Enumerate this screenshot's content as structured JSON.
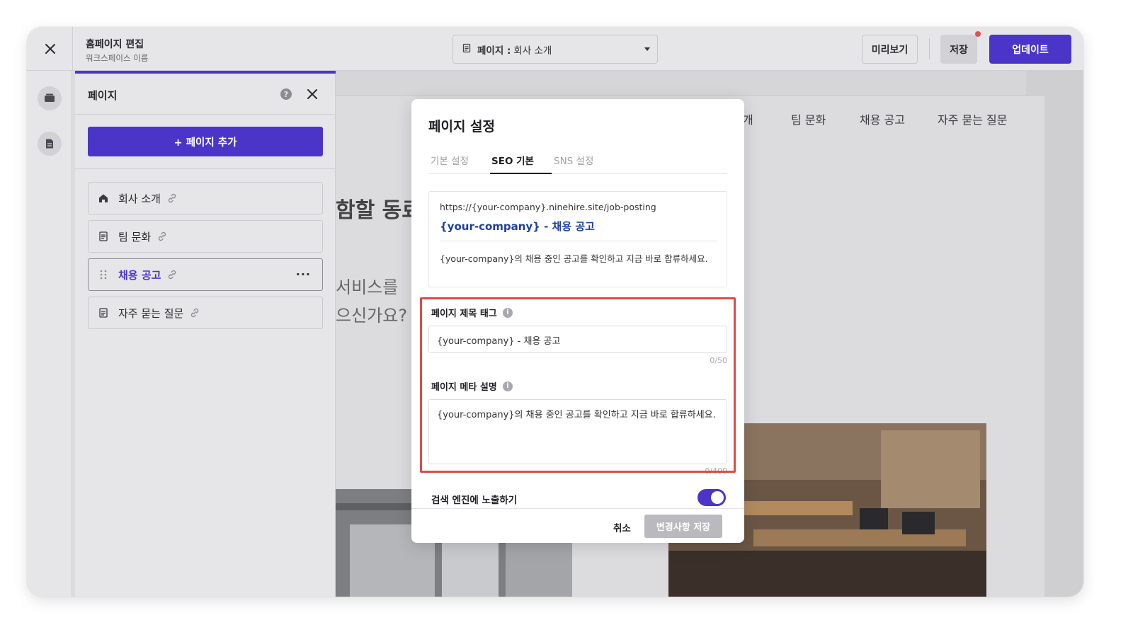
{
  "topbar": {
    "title": "홈페이지 편집",
    "subtitle": "워크스페이스 이름",
    "page_select_label": "페이지 :",
    "page_select_value": "회사 소개",
    "preview_label": "미리보기",
    "save_label": "저장",
    "update_label": "업데이트"
  },
  "rail": {
    "help": "?"
  },
  "panel": {
    "title": "페이지",
    "help": "?",
    "add_page_label": "+ 페이지 추가",
    "items": [
      {
        "label": "회사 소개",
        "icon": "home-icon"
      },
      {
        "label": "팀 문화",
        "icon": "page-icon"
      },
      {
        "label": "채용 공고",
        "icon": "drag-handle-icon",
        "active": true,
        "more": "···"
      },
      {
        "label": "자주 묻는 질문",
        "icon": "page-icon"
      }
    ]
  },
  "site": {
    "nav": [
      "개",
      "팀 문화",
      "채용 공고",
      "자주 묻는 질문"
    ],
    "hero_fragment": "함할 동료",
    "sub_line1": "서비스를",
    "sub_line2": "으신가요?"
  },
  "modal": {
    "title": "페이지 설정",
    "tabs": [
      "기본 설정",
      "SEO 기본",
      "SNS 설정"
    ],
    "active_tab": "SEO 기본",
    "preview": {
      "url": "https://{your-company}.ninehire.site/job-posting",
      "title": "{your-company} - 채용 공고",
      "description": "{your-company}의 채용 중인 공고를 확인하고 지금 바로 합류하세요."
    },
    "title_tag": {
      "label": "페이지 제목 태그",
      "value": "{your-company} - 채용 공고",
      "counter": "0/50"
    },
    "meta_desc": {
      "label": "페이지 메타 설명",
      "value": "{your-company}의 채용 중인 공고를 확인하고 지금 바로 합류하세요.",
      "counter": "0/400"
    },
    "search_toggle": {
      "label": "검색 엔진에 노출하기",
      "on": true
    },
    "cancel_label": "취소",
    "commit_label": "변경사항 저장"
  },
  "colors": {
    "accent": "#4b35c9",
    "highlight": "#dc4b47",
    "link_title": "#1d3fa0"
  }
}
